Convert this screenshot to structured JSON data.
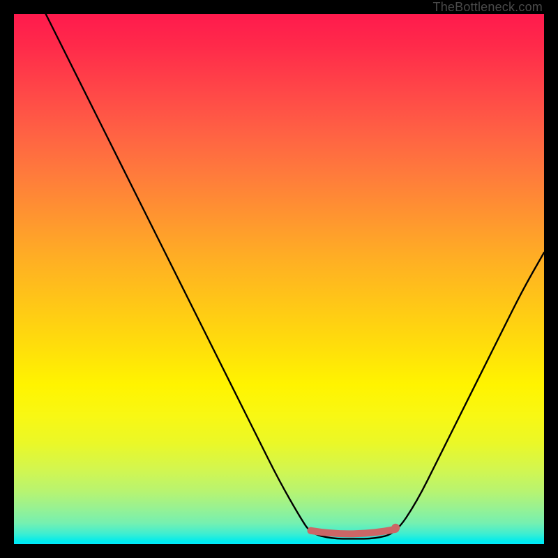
{
  "watermark": "TheBottleneck.com",
  "chart_data": {
    "type": "line",
    "title": "",
    "xlabel": "",
    "ylabel": "",
    "xlim": [
      0,
      100
    ],
    "ylim": [
      0,
      100
    ],
    "grid": false,
    "background": "gradient-red-yellow-cyan",
    "annotations": [
      {
        "name": "valley-highlight",
        "color": "#cc6666",
        "x_range": [
          56,
          72
        ],
        "y": 2
      }
    ],
    "series": [
      {
        "name": "curve",
        "color": "#000000",
        "x": [
          6,
          10,
          14,
          18,
          22,
          26,
          30,
          34,
          38,
          42,
          46,
          50,
          54,
          56,
          60,
          64,
          68,
          72,
          76,
          80,
          84,
          88,
          92,
          96,
          100
        ],
        "values": [
          100,
          92,
          84,
          76,
          68,
          60,
          52,
          44,
          36,
          28,
          20,
          12,
          5,
          2,
          1,
          1,
          1,
          2,
          8,
          16,
          24,
          32,
          40,
          48,
          55
        ]
      }
    ]
  }
}
